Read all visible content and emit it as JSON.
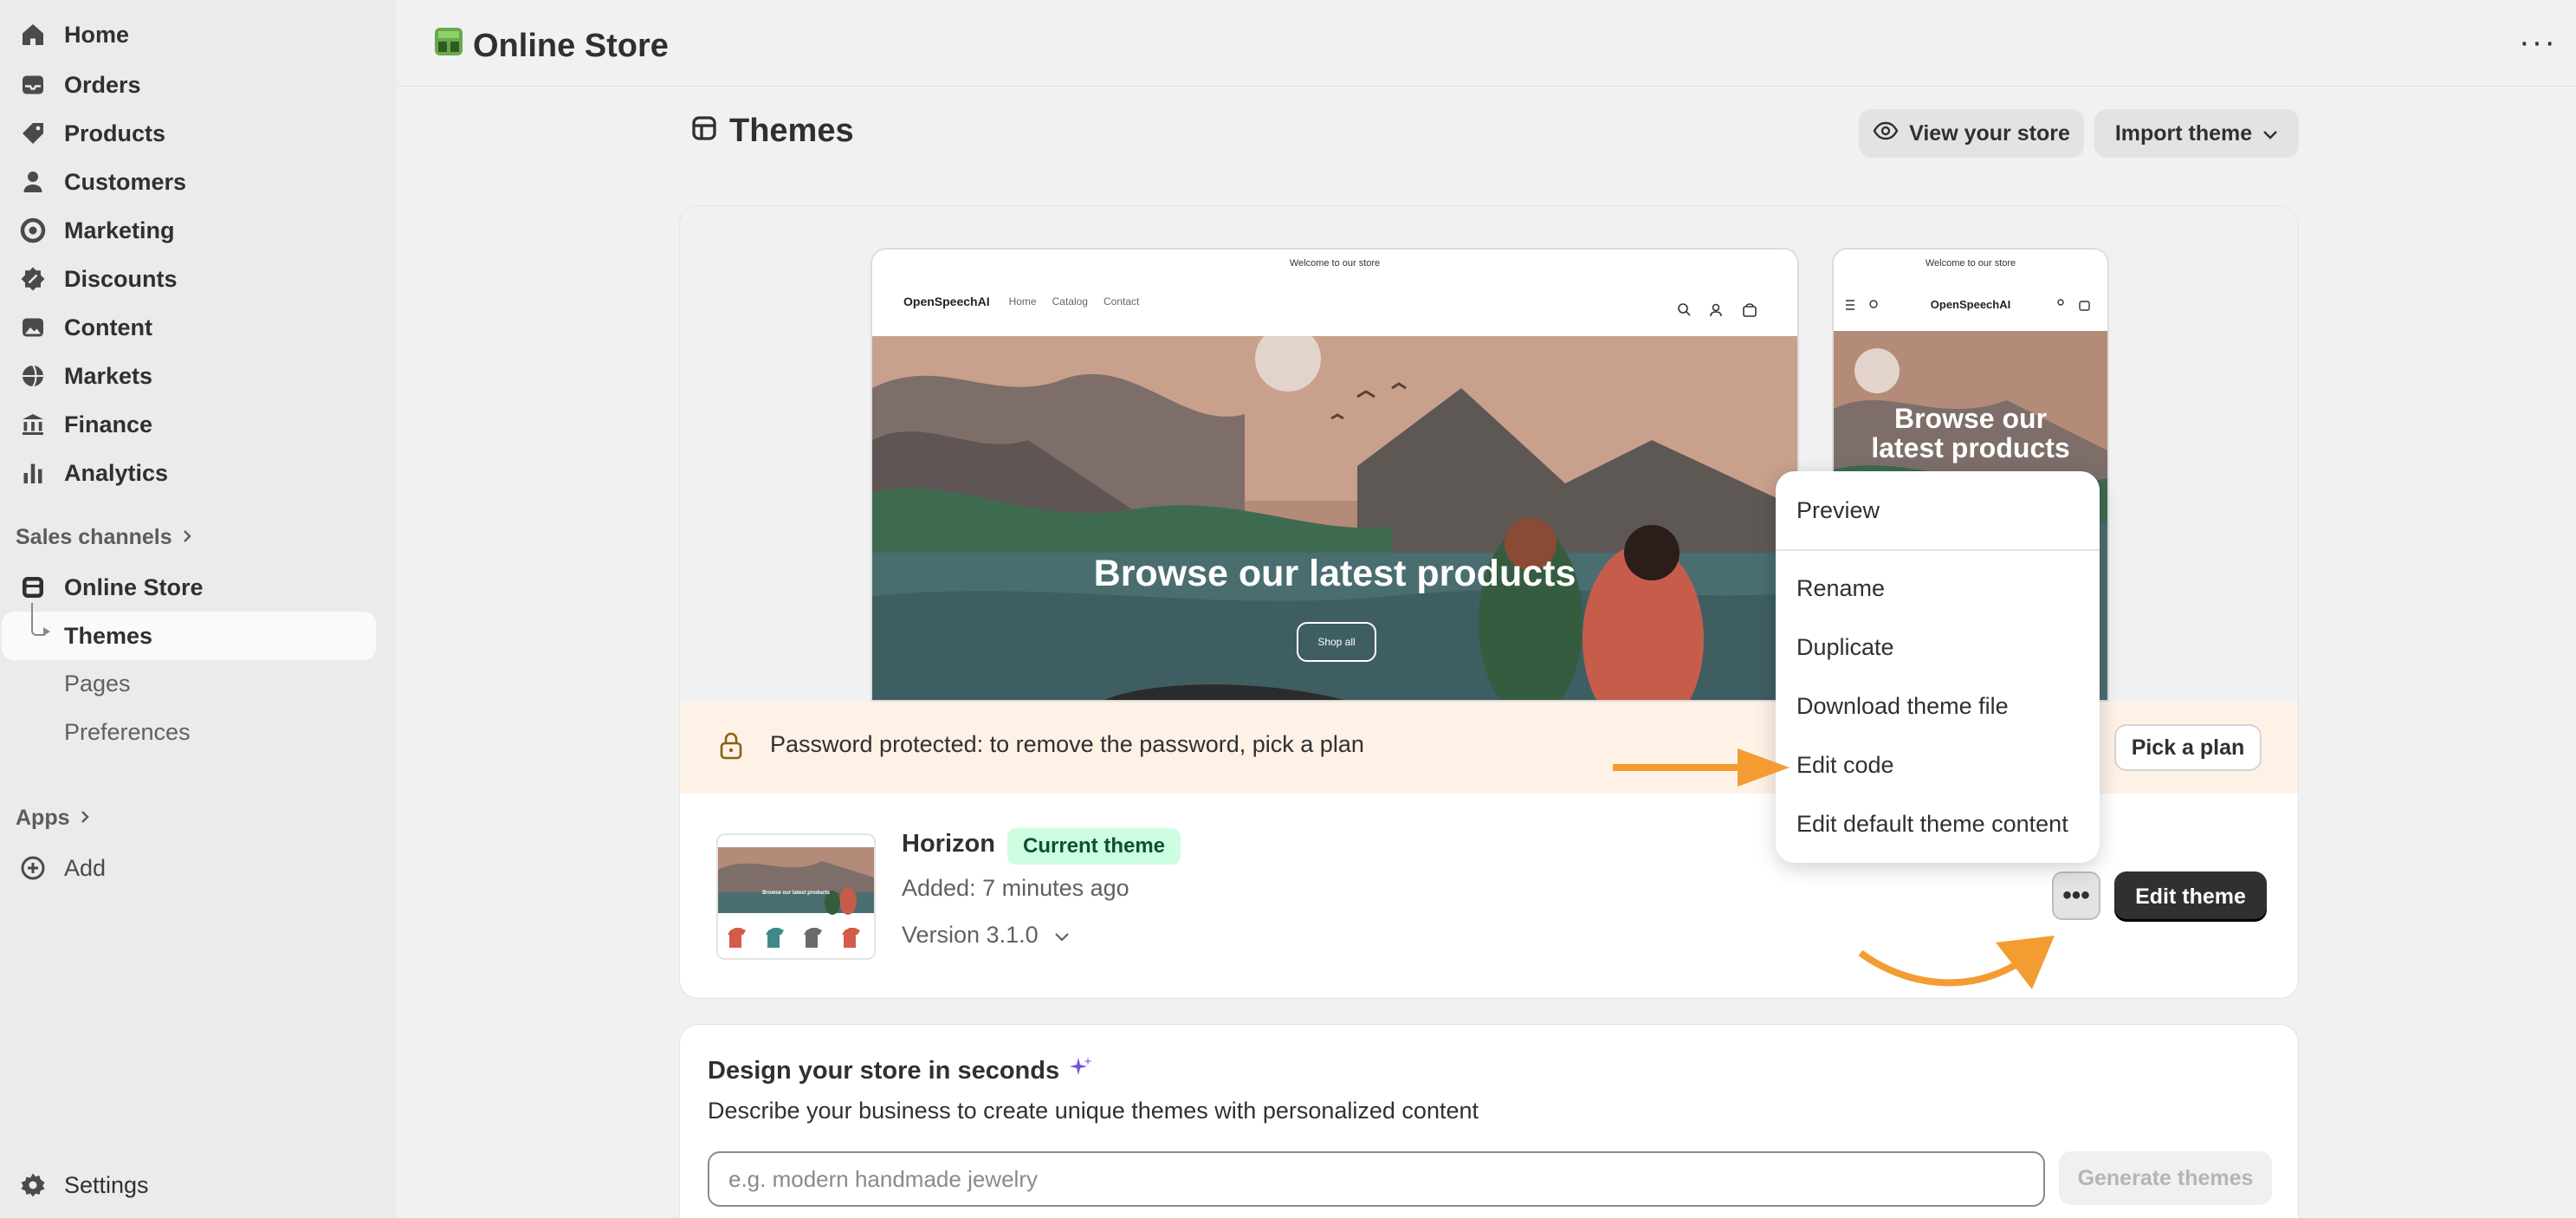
{
  "sidebar": {
    "items": [
      {
        "label": "Home",
        "icon": "home-icon"
      },
      {
        "label": "Orders",
        "icon": "inbox-icon"
      },
      {
        "label": "Products",
        "icon": "tag-icon"
      },
      {
        "label": "Customers",
        "icon": "person-icon"
      },
      {
        "label": "Marketing",
        "icon": "target-icon"
      },
      {
        "label": "Discounts",
        "icon": "discount-icon"
      },
      {
        "label": "Content",
        "icon": "image-icon"
      },
      {
        "label": "Markets",
        "icon": "globe-icon"
      },
      {
        "label": "Finance",
        "icon": "bank-icon"
      },
      {
        "label": "Analytics",
        "icon": "bar-chart-icon"
      }
    ],
    "sales_channels_label": "Sales channels",
    "online_store_label": "Online Store",
    "themes_label": "Themes",
    "pages_label": "Pages",
    "preferences_label": "Preferences",
    "apps_label": "Apps",
    "add_label": "Add",
    "settings_label": "Settings"
  },
  "topbar": {
    "title": "Online Store",
    "more": "···"
  },
  "page": {
    "title": "Themes",
    "view_store_label": "View your store",
    "import_theme_label": "Import theme"
  },
  "preview": {
    "announcement": "Welcome to our store",
    "brand": "OpenSpeechAI",
    "nav": [
      "Home",
      "Catalog",
      "Contact"
    ],
    "hero_text": "Browse our latest products",
    "mobile_hero_line1": "Browse our",
    "mobile_hero_line2": "latest products",
    "shop_all": "Shop all"
  },
  "banner": {
    "text": "Password protected: to remove the password, pick a plan",
    "pick_plan_label": "Pick a plan"
  },
  "theme": {
    "name": "Horizon",
    "badge": "Current theme",
    "added": "Added: 7 minutes ago",
    "version": "Version 3.1.0",
    "more_label": "•••",
    "edit_label": "Edit theme",
    "thumb_text": "Browse our latest products"
  },
  "menu": {
    "items": [
      "Preview",
      "Rename",
      "Duplicate",
      "Download theme file",
      "Edit code",
      "Edit default theme content"
    ]
  },
  "design": {
    "title": "Design your store in seconds",
    "description": "Describe your business to create unique themes with personalized content",
    "placeholder": "e.g. modern handmade jewelry",
    "generate_label": "Generate themes"
  },
  "colors": {
    "accent_arrow": "#f39c32",
    "badge_bg": "#cdfee1",
    "banner_bg": "#fef1e6",
    "primary_button": "#303030"
  }
}
